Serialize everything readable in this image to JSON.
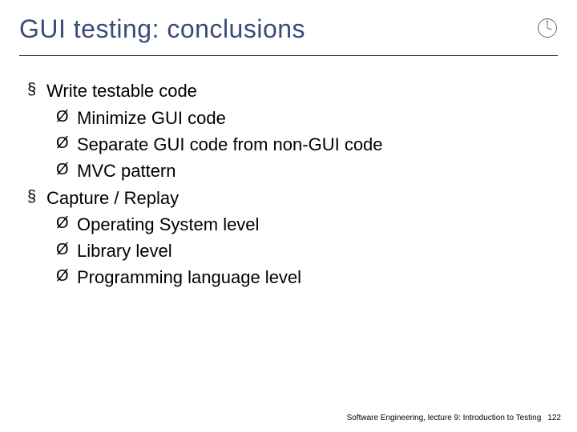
{
  "title": "GUI testing: conclusions",
  "bullets": [
    {
      "text": "Write testable code",
      "sub": [
        "Minimize GUI code",
        "Separate GUI code from non-GUI code",
        "MVC pattern"
      ]
    },
    {
      "text": "Capture / Replay",
      "sub": [
        "Operating System level",
        "Library level",
        "Programming language level"
      ]
    }
  ],
  "footer": {
    "text": "Software Engineering, lecture 9: Introduction to Testing",
    "page": "122"
  }
}
